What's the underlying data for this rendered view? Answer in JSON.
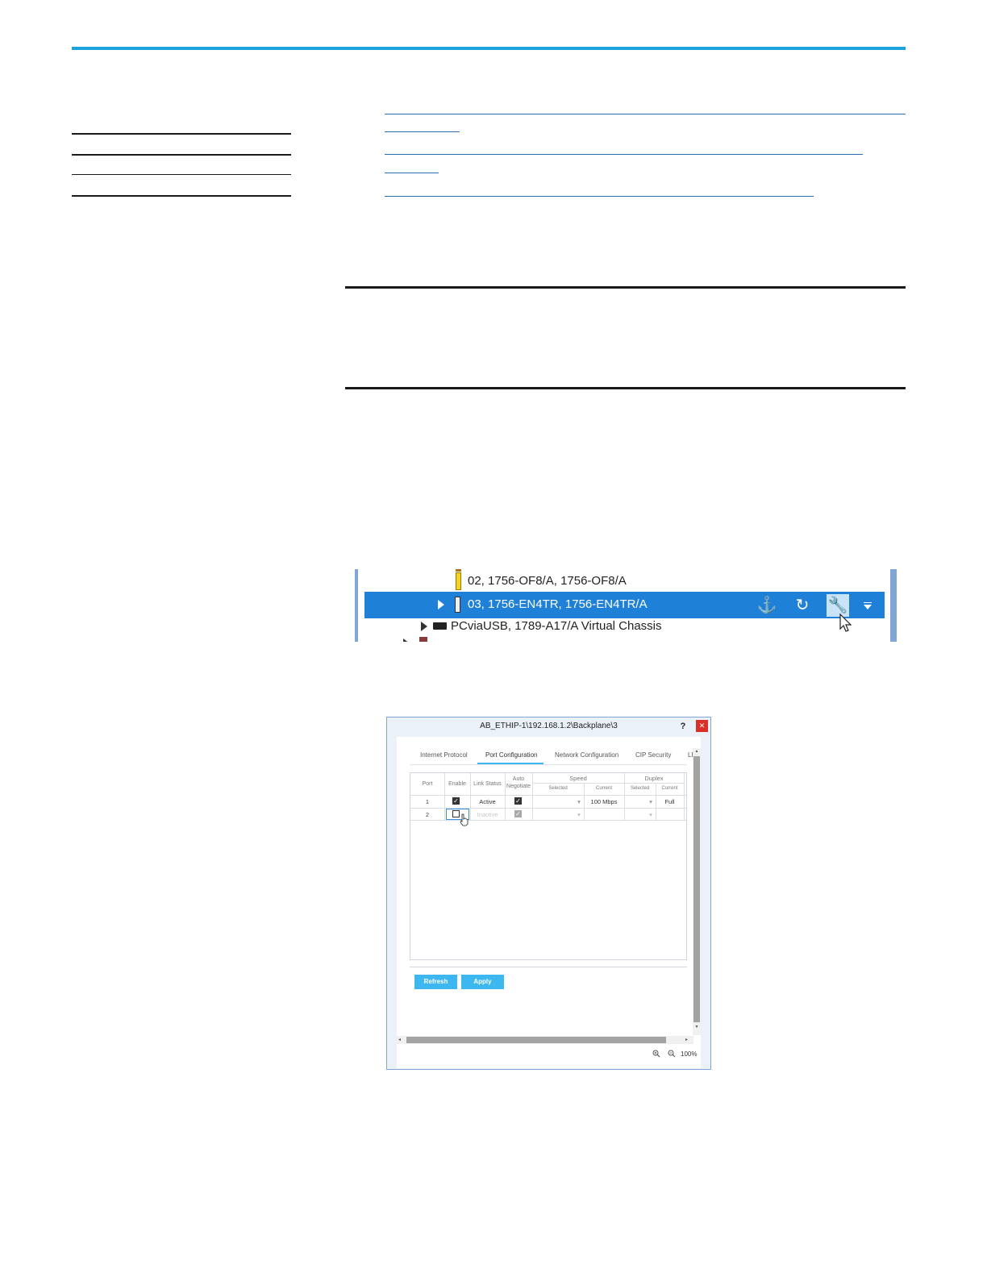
{
  "tree": {
    "rows": [
      {
        "label": "02, 1756-OF8/A, 1756-OF8/A"
      },
      {
        "label": "03, 1756-EN4TR, 1756-EN4TR/A"
      },
      {
        "label": "PCviaUSB, 1789-A17/A Virtual Chassis"
      }
    ],
    "toolbar": {
      "anchor_icon": "anchor-icon",
      "refresh_icon": "refresh-icon",
      "wrench_icon": "wrench-icon",
      "menu_icon": "dropdown-icon"
    }
  },
  "dialog": {
    "title": "AB_ETHIP-1\\192.168.1.2\\Backplane\\3",
    "help_label": "?",
    "close_label": "✕",
    "tabs": [
      "Internet Protocol",
      "Port Configuration",
      "Network Configuration",
      "CIP Security",
      "LL"
    ],
    "active_tab": "Port Configuration",
    "columns": {
      "port": "Port",
      "enable": "Enable",
      "link_status": "Link Status",
      "auto_negotiate_1": "Auto",
      "auto_negotiate_2": "Negotiate",
      "speed": "Speed",
      "speed_selected": "Selected",
      "speed_current": "Current",
      "duplex": "Duplex",
      "duplex_selected": "Selected",
      "duplex_current": "Current"
    },
    "rows": [
      {
        "port": "1",
        "enabled": true,
        "link_status": "Active",
        "auto_negotiate": true,
        "speed_current": "100 Mbps",
        "duplex_current": "Full"
      },
      {
        "port": "2",
        "enabled": false,
        "link_status": "Inactive",
        "auto_negotiate": true,
        "speed_current": "",
        "duplex_current": ""
      }
    ],
    "buttons": {
      "refresh": "Refresh",
      "apply": "Apply"
    },
    "zoom": "100%"
  },
  "colors": {
    "accent": "#1aa3dd",
    "selection": "#1f80d8",
    "button": "#3cb7ef"
  }
}
